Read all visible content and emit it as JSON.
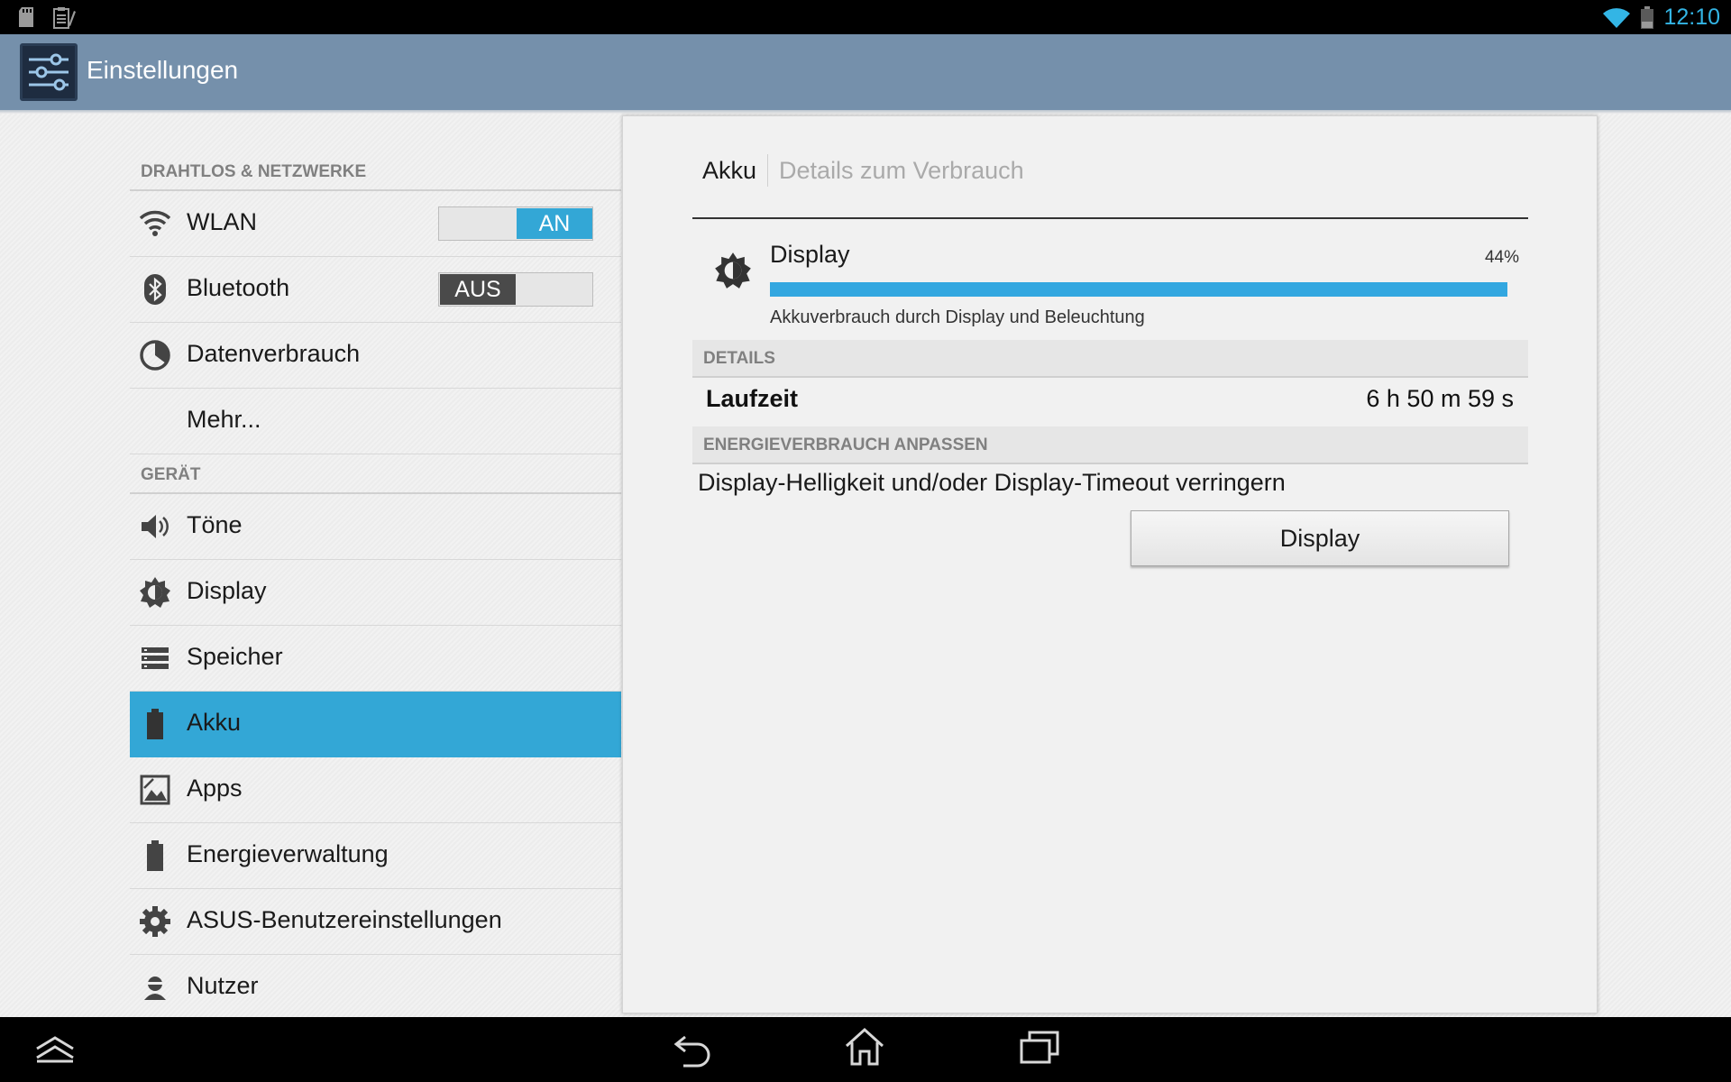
{
  "status_bar": {
    "time": "12:10",
    "left_icons": [
      "sd-card-icon",
      "clipboard-icon"
    ],
    "right_icons": [
      "wifi-icon",
      "battery-icon"
    ],
    "accent_color": "#33b5e5"
  },
  "action_bar": {
    "title": "Einstellungen",
    "icon": "settings-sliders-icon",
    "color": "#7590ab"
  },
  "sidebar": {
    "categories": [
      {
        "label": "DRAHTLOS & NETZWERKE"
      },
      {
        "label": "GERÄT"
      }
    ],
    "items": [
      {
        "label": "WLAN",
        "icon": "wifi-icon",
        "toggle": "AN"
      },
      {
        "label": "Bluetooth",
        "icon": "bluetooth-icon",
        "toggle": "AUS"
      },
      {
        "label": "Datenverbrauch",
        "icon": "data-usage-icon"
      },
      {
        "label": "Mehr..."
      },
      {
        "label": "Töne",
        "icon": "speaker-icon"
      },
      {
        "label": "Display",
        "icon": "brightness-icon"
      },
      {
        "label": "Speicher",
        "icon": "storage-icon"
      },
      {
        "label": "Akku",
        "icon": "battery-icon",
        "selected": true
      },
      {
        "label": "Apps",
        "icon": "apps-icon"
      },
      {
        "label": "Energieverwaltung",
        "icon": "battery-icon"
      },
      {
        "label": "ASUS-Benutzereinstellungen",
        "icon": "gear-icon"
      },
      {
        "label": "Nutzer",
        "icon": "user-icon"
      }
    ],
    "selected_color": "#33a7d6"
  },
  "detail": {
    "breadcrumb": {
      "current": "Akku",
      "next": "Details zum Verbrauch"
    },
    "usage": {
      "name": "Display",
      "percent_label": "44%",
      "bar_fraction": 1.0,
      "description": "Akkuverbrauch durch Display und Beleuchtung"
    },
    "details_header": "DETAILS",
    "runtime_label": "Laufzeit",
    "runtime_value": "6 h 50 m 59 s",
    "adjust_header": "ENERGIEVERBRAUCH ANPASSEN",
    "adjust_hint": "Display-Helligkeit und/oder Display-Timeout verringern",
    "adjust_button": "Display"
  },
  "nav_bar": {
    "icons": [
      "up-icon",
      "back-icon",
      "home-icon",
      "recents-icon"
    ]
  }
}
